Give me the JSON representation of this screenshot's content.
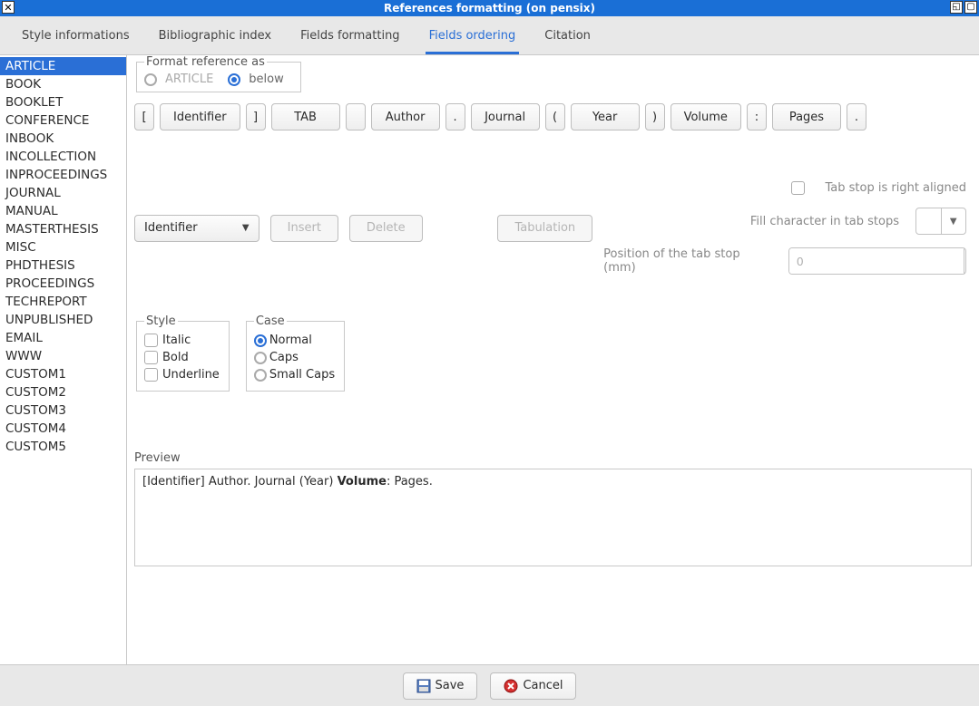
{
  "window": {
    "title": "References formatting (on pensix)"
  },
  "tabs": [
    {
      "label": "Style informations"
    },
    {
      "label": "Bibliographic index"
    },
    {
      "label": "Fields formatting"
    },
    {
      "label": "Fields ordering"
    },
    {
      "label": "Citation"
    }
  ],
  "active_tab_index": 3,
  "sidebar": {
    "items": [
      "ARTICLE",
      "BOOK",
      "BOOKLET",
      "CONFERENCE",
      "INBOOK",
      "INCOLLECTION",
      "INPROCEEDINGS",
      "JOURNAL",
      "MANUAL",
      "MASTERTHESIS",
      "MISC",
      "PHDTHESIS",
      "PROCEEDINGS",
      "TECHREPORT",
      "UNPUBLISHED",
      "EMAIL",
      "WWW",
      "CUSTOM1",
      "CUSTOM2",
      "CUSTOM3",
      "CUSTOM4",
      "CUSTOM5"
    ],
    "selected_index": 0
  },
  "format_as": {
    "legend": "Format reference as",
    "option_article": "ARTICLE",
    "option_below": "below",
    "selected": "below"
  },
  "tokens": [
    {
      "txt": "[",
      "type": "sep"
    },
    {
      "txt": "Identifier",
      "type": "field"
    },
    {
      "txt": "]",
      "type": "sep"
    },
    {
      "txt": "TAB",
      "type": "field"
    },
    {
      "txt": "",
      "type": "sep"
    },
    {
      "txt": "Author",
      "type": "field"
    },
    {
      "txt": ".",
      "type": "sep"
    },
    {
      "txt": "Journal",
      "type": "field"
    },
    {
      "txt": "(",
      "type": "sep"
    },
    {
      "txt": "Year",
      "type": "field"
    },
    {
      "txt": ")",
      "type": "sep"
    },
    {
      "txt": "Volume",
      "type": "field"
    },
    {
      "txt": ":",
      "type": "sep"
    },
    {
      "txt": "Pages",
      "type": "field"
    },
    {
      "txt": ".",
      "type": "sep"
    }
  ],
  "field_combo": {
    "value": "Identifier"
  },
  "buttons": {
    "insert": "Insert",
    "delete": "Delete",
    "tabulation": "Tabulation"
  },
  "tab_opts": {
    "right_aligned": "Tab stop is right aligned",
    "fill_char": "Fill character in tab stops",
    "position": "Position of the tab stop (mm)",
    "position_value": "0"
  },
  "style": {
    "legend": "Style",
    "italic": "Italic",
    "bold": "Bold",
    "underline": "Underline"
  },
  "case": {
    "legend": "Case",
    "normal": "Normal",
    "caps": "Caps",
    "small_caps": "Small Caps",
    "selected": "normal"
  },
  "preview": {
    "label": "Preview",
    "text_pre": "[Identifier]    Author. Journal (Year) ",
    "text_bold": "Volume",
    "text_post": ": Pages."
  },
  "footer": {
    "save": "Save",
    "cancel": "Cancel"
  }
}
